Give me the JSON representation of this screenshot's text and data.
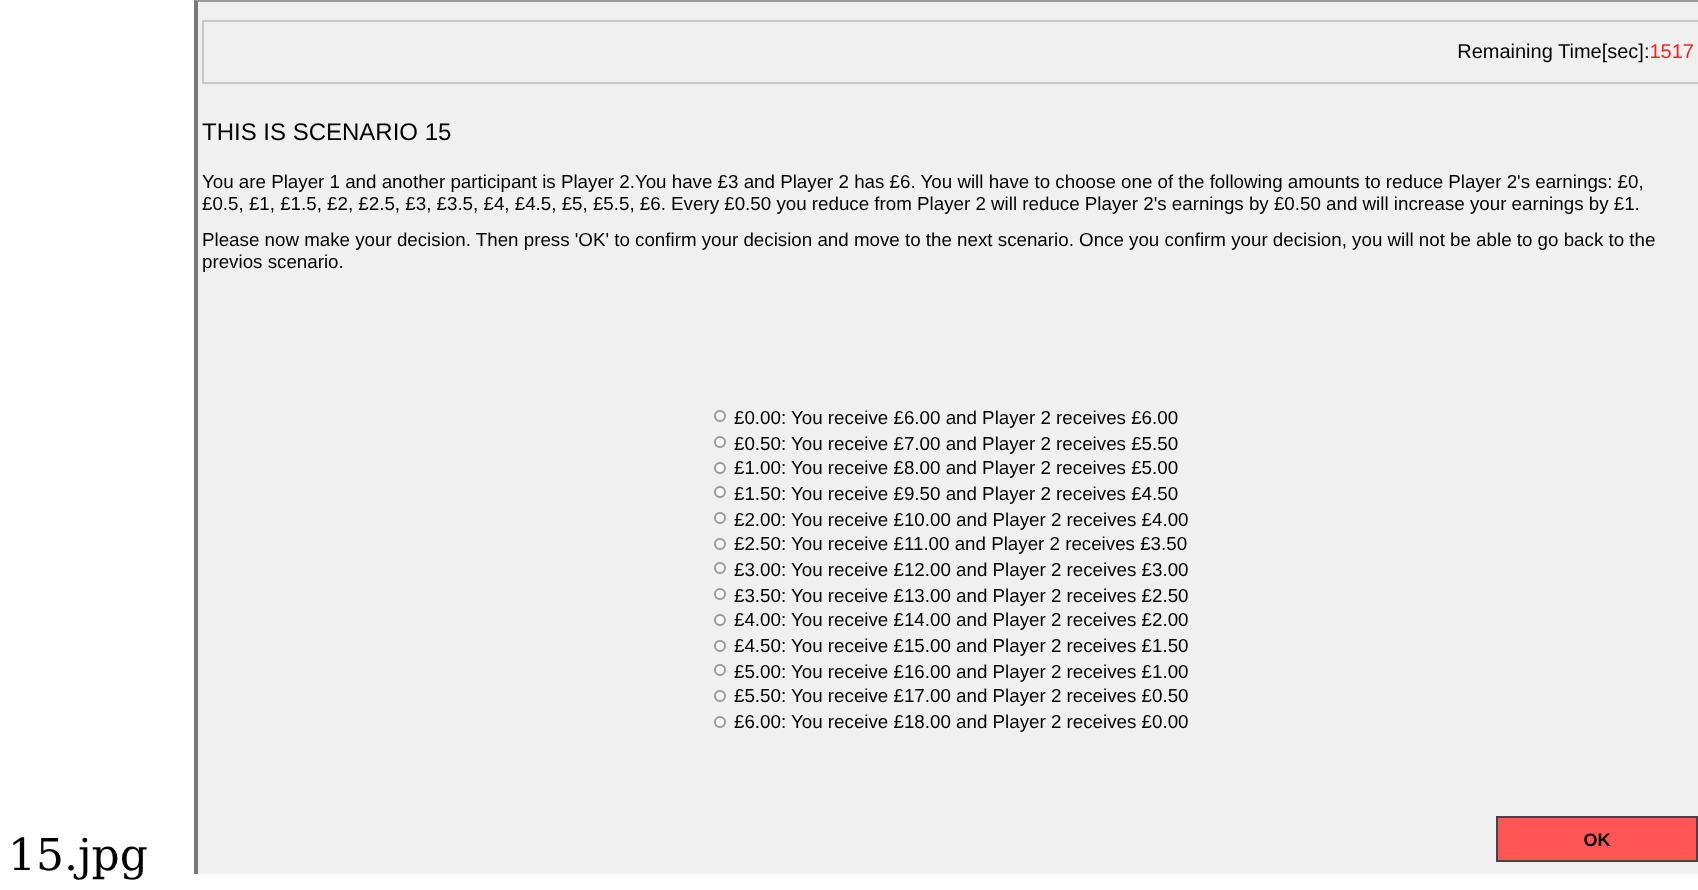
{
  "caption": "15.jpg",
  "header": {
    "timer_label": "Remaining Time[sec]:",
    "timer_value": "1517"
  },
  "title": "THIS IS SCENARIO 15",
  "paragraphs": [
    "You are Player 1 and another participant is Player 2.You have £3 and Player 2 has £6. You will have to choose one of the following amounts to reduce Player 2's earnings: £0, £0.5, £1, £1.5, £2, £2.5, £3, £3.5, £4, £4.5, £5, £5.5, £6. Every £0.50 you reduce from Player 2 will reduce Player 2's earnings by £0.50 and will increase your earnings by £1.",
    "Please now make your decision. Then press 'OK' to confirm your decision and move to the next scenario. Once you confirm your decision, you will not be able to go back to the previos scenario."
  ],
  "options": [
    {
      "label": "£0.00: You receive £6.00 and Player 2 receives £6.00",
      "selected": false
    },
    {
      "label": "£0.50: You receive £7.00 and Player 2 receives £5.50",
      "selected": false
    },
    {
      "label": "£1.00: You receive £8.00 and Player 2 receives £5.00",
      "selected": false
    },
    {
      "label": "£1.50: You receive £9.50 and Player 2 receives £4.50",
      "selected": false
    },
    {
      "label": "£2.00: You receive £10.00 and Player 2 receives £4.00",
      "selected": false
    },
    {
      "label": "£2.50: You receive £11.00 and Player 2 receives £3.50",
      "selected": false
    },
    {
      "label": "£3.00: You receive £12.00 and Player 2 receives £3.00",
      "selected": false
    },
    {
      "label": "£3.50: You receive £13.00 and Player 2 receives £2.50",
      "selected": false
    },
    {
      "label": "£4.00: You receive £14.00 and Player 2 receives £2.00",
      "selected": false
    },
    {
      "label": "£4.50: You receive £15.00 and Player 2 receives £1.50",
      "selected": false
    },
    {
      "label": "£5.00: You receive £16.00 and Player 2 receives £1.00",
      "selected": false
    },
    {
      "label": "£5.50: You receive £17.00 and Player 2 receives £0.50",
      "selected": false
    },
    {
      "label": "£6.00: You receive £18.00 and Player 2 receives £0.00",
      "selected": false
    }
  ],
  "ok_button": "OK"
}
